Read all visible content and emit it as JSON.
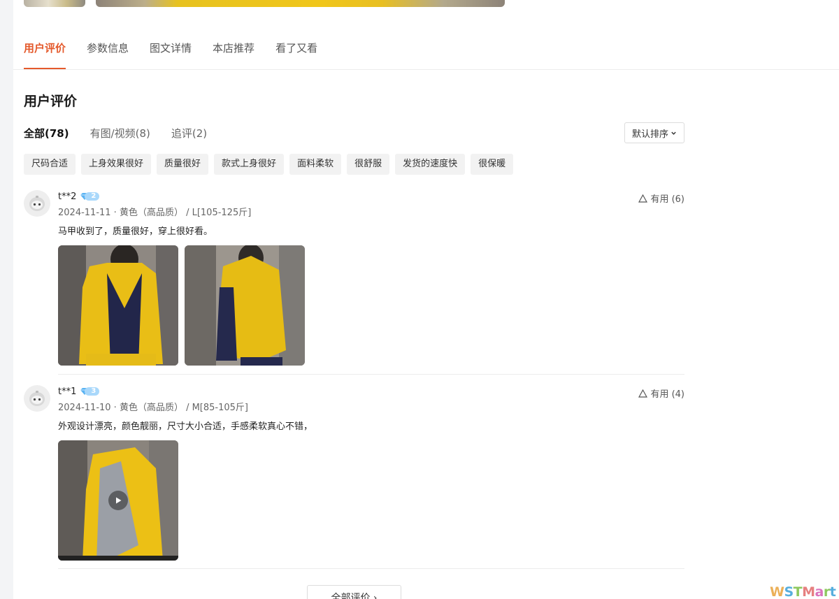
{
  "tabs": [
    "用户评价",
    "参数信息",
    "图文详情",
    "本店推荐",
    "看了又看"
  ],
  "section_title": "用户评价",
  "filters": [
    "全部(78)",
    "有图/视频(8)",
    "追评(2)"
  ],
  "sort": {
    "label": "默认排序"
  },
  "tags": [
    "尺码合适",
    "上身效果很好",
    "质量很好",
    "款式上身很好",
    "面料柔软",
    "很舒服",
    "发货的速度快",
    "很保暖"
  ],
  "reviews": [
    {
      "user": "t**2",
      "level": "2",
      "meta": "2024-11-11 · 黄色（高品质） / L[105-125斤]",
      "text": "马甲收到了，质量很好，穿上很好看。",
      "helpful": "有用 (6)",
      "media": [
        "photo",
        "photo"
      ]
    },
    {
      "user": "t**1",
      "level": "3",
      "meta": "2024-11-10 · 黄色（高品质） / M[85-105斤]",
      "text": "外观设计漂亮，颜色靓丽，尺寸大小合适，手感柔软真心不错，",
      "helpful": "有用 (4)",
      "media": [
        "video"
      ]
    }
  ],
  "all_reviews_label": "全部评价 ›",
  "watermark": {
    "letters": [
      "W",
      "S",
      "T",
      "M",
      "a",
      "r",
      "t"
    ],
    "colors": [
      "#e8a33c",
      "#3aa0d8",
      "#7bbf44",
      "#e26a6a",
      "#d45bb2",
      "#7bbf44",
      "#3aa0d8"
    ]
  },
  "colors": {
    "accent": "#e4592b",
    "badge": "#a9d8fb"
  }
}
